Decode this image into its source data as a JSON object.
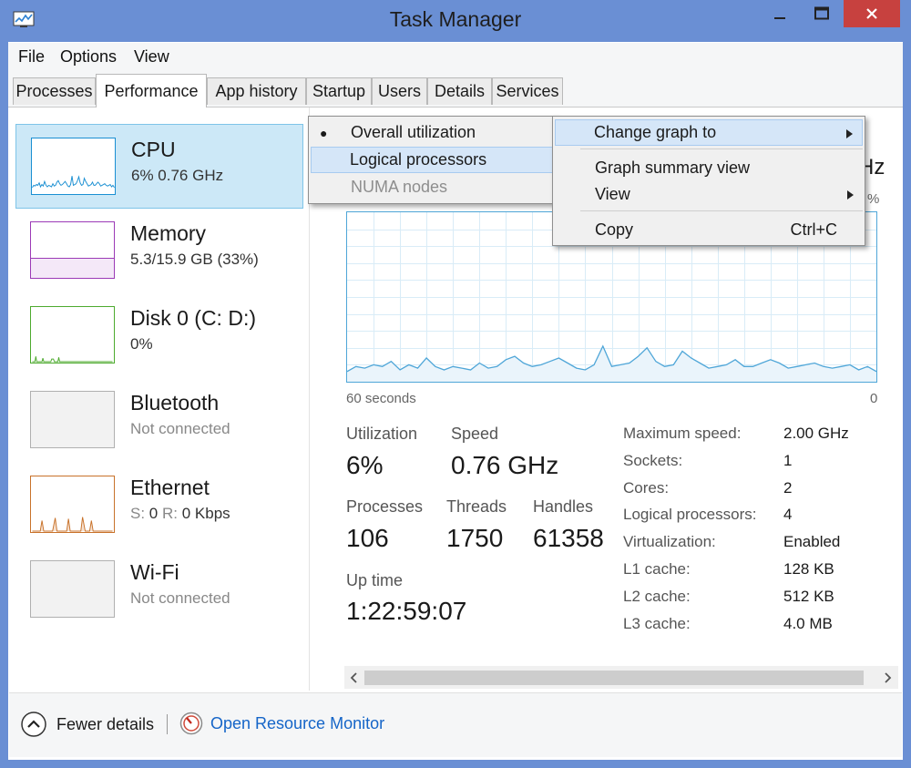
{
  "window": {
    "title": "Task Manager"
  },
  "menubar": {
    "items": [
      "File",
      "Options",
      "View"
    ]
  },
  "tabs": [
    {
      "label": "Processes"
    },
    {
      "label": "Performance",
      "active": true
    },
    {
      "label": "App history"
    },
    {
      "label": "Startup"
    },
    {
      "label": "Users"
    },
    {
      "label": "Details"
    },
    {
      "label": "Services"
    }
  ],
  "resources": [
    {
      "name": "CPU",
      "detail": "6%  0.76 GHz",
      "selected": true,
      "color": "#1a8fd2"
    },
    {
      "name": "Memory",
      "detail": "5.3/15.9 GB (33%)",
      "color": "#9b3ab6"
    },
    {
      "name": "Disk 0 (C: D:)",
      "detail": "0%",
      "color": "#4daa2e"
    },
    {
      "name": "Bluetooth",
      "detail": "Not connected",
      "color": "#b0b0b0"
    },
    {
      "name": "Ethernet",
      "detail_prefix": "S: ",
      "detail_s": "0",
      "detail_mid": " R: ",
      "detail_r": "0 Kbps",
      "color": "#c8722a"
    },
    {
      "name": "Wi-Fi",
      "detail": "Not connected",
      "color": "#b0b0b0"
    }
  ],
  "graph": {
    "left_label": "60 seconds",
    "right_label": "0",
    "partial_right_top": "Hz",
    "partial_right_pct": "%"
  },
  "stats": {
    "utilization_label": "Utilization",
    "utilization_value": "6%",
    "speed_label": "Speed",
    "speed_value": "0.76 GHz",
    "processes_label": "Processes",
    "processes_value": "106",
    "threads_label": "Threads",
    "threads_value": "1750",
    "handles_label": "Handles",
    "handles_value": "61358",
    "uptime_label": "Up time",
    "uptime_value": "1:22:59:07"
  },
  "specs": [
    {
      "label": "Maximum speed:",
      "value": "2.00 GHz"
    },
    {
      "label": "Sockets:",
      "value": "1"
    },
    {
      "label": "Cores:",
      "value": "2"
    },
    {
      "label": "Logical processors:",
      "value": "4"
    },
    {
      "label": "Virtualization:",
      "value": "Enabled"
    },
    {
      "label": "L1 cache:",
      "value": "128 KB"
    },
    {
      "label": "L2 cache:",
      "value": "512 KB"
    },
    {
      "label": "L3 cache:",
      "value": "4.0 MB"
    }
  ],
  "context_menu": {
    "change_graph": "Change graph to",
    "summary_view": "Graph summary view",
    "view": "View",
    "copy": "Copy",
    "copy_shortcut": "Ctrl+C"
  },
  "submenu": {
    "overall": "Overall utilization",
    "logical": "Logical processors",
    "numa": "NUMA nodes",
    "bullet": "●"
  },
  "footer": {
    "fewer_details": "Fewer details",
    "resource_monitor": "Open Resource Monitor"
  },
  "cpu_history_pct": [
    6,
    9,
    8,
    10,
    9,
    12,
    7,
    10,
    8,
    14,
    9,
    7,
    9,
    8,
    7,
    11,
    8,
    9,
    13,
    15,
    11,
    9,
    10,
    12,
    14,
    11,
    8,
    7,
    10,
    21,
    9,
    10,
    11,
    15,
    20,
    12,
    9,
    10,
    18,
    14,
    11,
    8,
    9,
    10,
    13,
    9,
    9,
    11,
    13,
    11,
    8,
    9,
    10,
    11,
    9,
    8,
    9,
    10,
    7,
    9,
    6
  ]
}
